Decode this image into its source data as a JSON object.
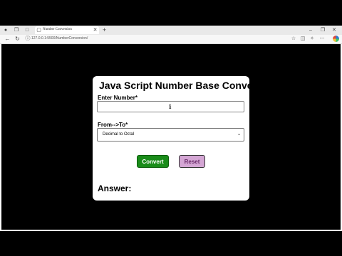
{
  "tab": {
    "title": "Number Conversion"
  },
  "address_bar": {
    "url": "127.0.0.1:5500/NumberConversion/"
  },
  "card": {
    "title": "Java Script Number Base Converter",
    "enter_label": "Enter Number*",
    "enter_value": "",
    "from_to_label": "From-->To*",
    "selected_option": "Decimal to Octal",
    "convert_label": "Convert",
    "reset_label": "Reset",
    "answer_label": "Answer:"
  },
  "icons": {
    "tabbar": [
      "profile-icon",
      "tab-collection-icon",
      "page-icon",
      "close-icon",
      "new-tab-icon",
      "minimize-icon",
      "restore-icon",
      "window-close-icon"
    ],
    "toolbar": [
      "back-icon",
      "refresh-icon",
      "info-icon",
      "favorites-icon",
      "split-screen-icon",
      "collections-icon",
      "more-icon",
      "edge-copilot-icon"
    ]
  },
  "colors": {
    "convert_bg": "#1a8c1a",
    "reset_bg": "#d4a6d4",
    "page_bg": "#000000"
  }
}
